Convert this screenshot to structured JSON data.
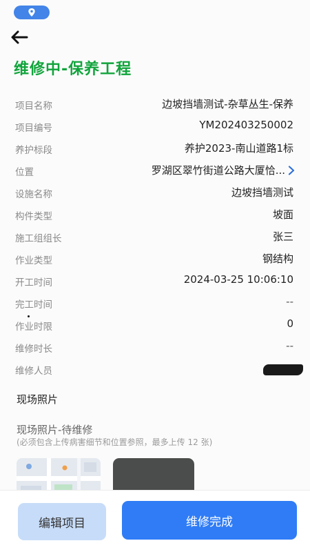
{
  "header": {
    "back_icon": "arrow-left-icon",
    "title": "维修中-保养工程"
  },
  "status_bar": {
    "location_icon": "location-pin-icon",
    "accent_color": "#4284e8"
  },
  "details": [
    {
      "label": "项目名称",
      "value": "边坡挡墙测试-杂草丛生-保养"
    },
    {
      "label": "项目编号",
      "value": "YM202403250002"
    },
    {
      "label": "养护标段",
      "value": "养护2023-南山道路1标"
    },
    {
      "label": "位置",
      "value": "罗湖区翠竹街道公路大厦恰...",
      "icon": "chevron-right-icon"
    },
    {
      "label": "设施名称",
      "value": "边坡挡墙测试"
    },
    {
      "label": "构件类型",
      "value": "坡面"
    },
    {
      "label": "施工组组长",
      "value": "张三"
    },
    {
      "label": "作业类型",
      "value": "钢结构"
    },
    {
      "label": "开工时间",
      "value": "2024-03-25 10:06:10"
    },
    {
      "label": "完工时间",
      "value": "--"
    },
    {
      "label": "作业时限",
      "value": "0"
    },
    {
      "label": "维修时长",
      "value": "--"
    },
    {
      "label": "维修人员",
      "value": ""
    }
  ],
  "photos": {
    "section_title": "现场照片",
    "subtitle": "现场照片-待维修",
    "hint": "(必须包含上传病害细节和位置参照，最多上传 12 张)"
  },
  "actions": {
    "edit_label": "编辑项目",
    "complete_label": "维修完成"
  },
  "colors": {
    "title_green": "#11a43c",
    "primary_blue": "#2f7cf6",
    "secondary_blue": "#c7dcf8"
  }
}
